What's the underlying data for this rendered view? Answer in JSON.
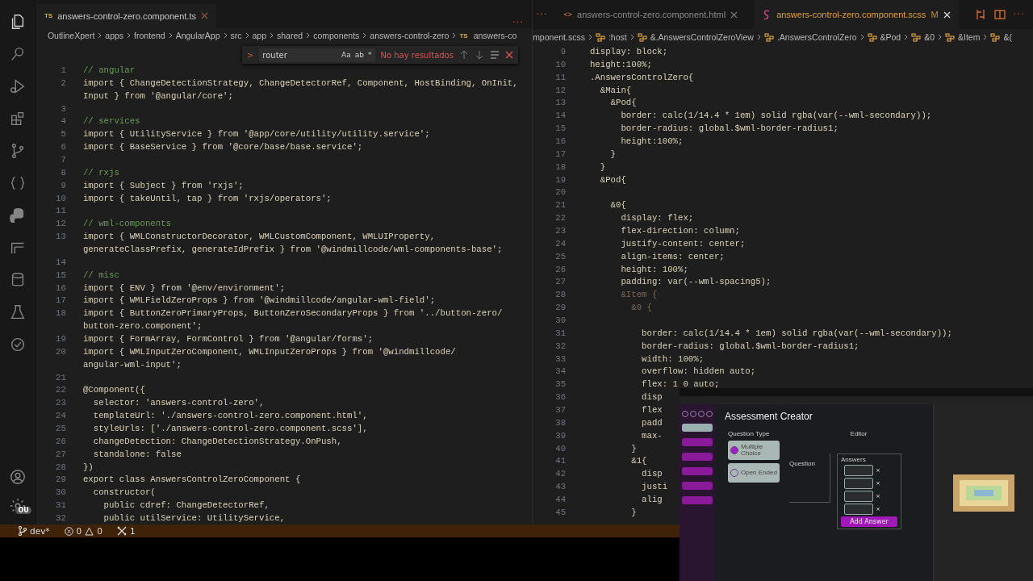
{
  "activity_bar": {
    "items": [
      {
        "kind": "files",
        "selected": true
      },
      {
        "kind": "search",
        "selected": false
      },
      {
        "kind": "run",
        "selected": false
      },
      {
        "kind": "extensions",
        "selected": false
      },
      {
        "kind": "branch",
        "selected": false
      },
      {
        "kind": "braces",
        "selected": false
      },
      {
        "kind": "python",
        "selected": false
      },
      {
        "kind": "panel",
        "selected": false
      },
      {
        "kind": "database",
        "selected": false
      },
      {
        "kind": "tests",
        "selected": false
      },
      {
        "kind": "check",
        "selected": false
      }
    ],
    "account_badge": "OU"
  },
  "left_editor": {
    "tabs": [
      {
        "icon": "TS",
        "label": "answers-control-zero.component.ts",
        "selected": true
      }
    ],
    "more": "···",
    "breadcrumbs": [
      "OutlineXpert",
      "apps",
      "frontend",
      "AngularApp",
      "src",
      "app",
      "shared",
      "components",
      "answers-control-zero",
      "answers-co"
    ],
    "breadcrumb_file_icon": "TS",
    "find": {
      "chevron": ">",
      "value": "router",
      "options": [
        "Aa",
        "ab",
        "*"
      ],
      "result": "No hay resultados"
    },
    "lines": [
      {
        "n": "1",
        "text": "// angular",
        "kind": "comment"
      },
      {
        "n": "2",
        "text": "import { ChangeDetectionStrategy, ChangeDetectorRef, Component, HostBinding, OnInit,",
        "kind": "code"
      },
      {
        "text": "Input } from '@angular/core';",
        "kind": "code"
      },
      {
        "n": "3"
      },
      {
        "n": "4",
        "text": "// services",
        "kind": "comment"
      },
      {
        "n": "5",
        "text": "import { UtilityService } from '@app/core/utility/utility.service';",
        "kind": "code"
      },
      {
        "n": "6",
        "text": "import { BaseService } from '@core/base/base.service';",
        "kind": "code"
      },
      {
        "n": "7"
      },
      {
        "n": "8",
        "text": "// rxjs",
        "kind": "comment"
      },
      {
        "n": "9",
        "text": "import { Subject } from 'rxjs';",
        "kind": "code"
      },
      {
        "n": "10",
        "text": "import { takeUntil, tap } from 'rxjs/operators';",
        "kind": "code"
      },
      {
        "n": "11"
      },
      {
        "n": "12",
        "text": "// wml-components",
        "kind": "comment"
      },
      {
        "n": "13",
        "text": "import { WMLConstructorDecorator, WMLCustomComponent, WMLUIProperty,",
        "kind": "code"
      },
      {
        "text": "generateClassPrefix, generateIdPrefix } from '@windmillcode/wml-components-base';",
        "kind": "code"
      },
      {
        "n": "14"
      },
      {
        "n": "15",
        "text": "// misc",
        "kind": "comment"
      },
      {
        "n": "16",
        "text": "import { ENV } from '@env/environment';",
        "kind": "code"
      },
      {
        "n": "17",
        "text": "import { WMLFieldZeroProps } from '@windmillcode/angular-wml-field';",
        "kind": "code"
      },
      {
        "n": "18",
        "text": "import { ButtonZeroPrimaryProps, ButtonZeroSecondaryProps } from '../button-zero/",
        "kind": "code"
      },
      {
        "text": "button-zero.component';",
        "kind": "code"
      },
      {
        "n": "19",
        "text": "import { FormArray, FormControl } from '@angular/forms';",
        "kind": "code"
      },
      {
        "n": "20",
        "text": "import { WMLInputZeroComponent, WMLInputZeroProps } from '@windmillcode/",
        "kind": "code"
      },
      {
        "text": "angular-wml-input';",
        "kind": "code"
      },
      {
        "n": "21"
      },
      {
        "n": "22",
        "text": "@Component({",
        "kind": "code"
      },
      {
        "n": "23",
        "text": "  selector: 'answers-control-zero',",
        "kind": "code"
      },
      {
        "n": "24",
        "text": "  templateUrl: './answers-control-zero.component.html',",
        "kind": "code"
      },
      {
        "n": "25",
        "text": "  styleUrls: ['./answers-control-zero.component.scss'],",
        "kind": "code"
      },
      {
        "n": "26",
        "text": "  changeDetection: ChangeDetectionStrategy.OnPush,",
        "kind": "code"
      },
      {
        "n": "27",
        "text": "  standalone: false",
        "kind": "code"
      },
      {
        "n": "28",
        "text": "})",
        "kind": "code"
      },
      {
        "n": "29",
        "text": "export class AnswersControlZeroComponent {",
        "kind": "code"
      },
      {
        "n": "30",
        "text": "  constructor(",
        "kind": "code"
      },
      {
        "n": "31",
        "text": "    public cdref: ChangeDetectorRef,",
        "kind": "code"
      },
      {
        "n": "32",
        "text": "    public utilService: UtilityService,",
        "kind": "code"
      }
    ]
  },
  "right_editor": {
    "tabs": [
      {
        "kind": "html",
        "icon": "<>",
        "label": "answers-control-zero.component.html",
        "selected": false
      },
      {
        "kind": "scss",
        "label": "answers-control-zero.component.scss",
        "modified": "M",
        "selected": true
      }
    ],
    "more": "···",
    "breadcrumbs": [
      "mponent.scss",
      ":host",
      "&.AnswersControlZeroView",
      ".AnswersControlZero",
      "&Pod",
      "&0",
      "&Item",
      "&("
    ],
    "lines": [
      {
        "n": "9",
        "text": "  display: block;",
        "kind": "code"
      },
      {
        "n": "10",
        "text": "  height:100%;",
        "kind": "code"
      },
      {
        "n": "11",
        "text": "  .AnswersControlZero{",
        "kind": "code"
      },
      {
        "n": "12",
        "text": "    &Main{",
        "kind": "code"
      },
      {
        "n": "13",
        "text": "      &Pod{",
        "kind": "code"
      },
      {
        "n": "14",
        "text": "        border: calc(1/14.4 * 1em) solid rgba(var(--wml-secondary));",
        "kind": "code"
      },
      {
        "n": "15",
        "text": "        border-radius: global.$wml-border-radius1;",
        "kind": "code"
      },
      {
        "n": "16",
        "text": "        height:100%;",
        "kind": "code"
      },
      {
        "n": "17",
        "text": "      }",
        "kind": "code"
      },
      {
        "n": "18",
        "text": "    }",
        "kind": "code"
      },
      {
        "n": "19",
        "text": "    &Pod{",
        "kind": "code"
      },
      {
        "n": "20"
      },
      {
        "n": "21",
        "text": "      &0{",
        "kind": "code"
      },
      {
        "n": "22",
        "text": "        display: flex;",
        "kind": "code"
      },
      {
        "n": "23",
        "text": "        flex-direction: column;",
        "kind": "code"
      },
      {
        "n": "24",
        "text": "        justify-content: center;",
        "kind": "code"
      },
      {
        "n": "25",
        "text": "        align-items: center;",
        "kind": "code"
      },
      {
        "n": "26",
        "text": "        height: 100%;",
        "kind": "code"
      },
      {
        "n": "27",
        "text": "        padding: var(--wml-spacing5);",
        "kind": "code"
      },
      {
        "n": "28",
        "text": "        &Item {",
        "kind": "dim"
      },
      {
        "n": "29",
        "text": "          &0 {",
        "kind": "dim"
      },
      {
        "n": "30"
      },
      {
        "n": "31",
        "text": "            border: calc(1/14.4 * 1em) solid rgba(var(--wml-secondary));",
        "kind": "code"
      },
      {
        "n": "32",
        "text": "            border-radius: global.$wml-border-radius1;",
        "kind": "code"
      },
      {
        "n": "33",
        "text": "            width: 100%;",
        "kind": "code"
      },
      {
        "n": "34",
        "text": "            overflow: hidden auto;",
        "kind": "code"
      },
      {
        "n": "35",
        "text": "            flex: 1 0 auto;",
        "kind": "code"
      },
      {
        "n": "36",
        "text": "            disp",
        "kind": "code"
      },
      {
        "n": "37",
        "text": "            flex",
        "kind": "code"
      },
      {
        "n": "38",
        "text": "            padd",
        "kind": "code"
      },
      {
        "n": "39",
        "text": "            max-",
        "kind": "code"
      },
      {
        "n": "40",
        "text": "          }",
        "kind": "code"
      },
      {
        "n": "41",
        "text": "          &1{",
        "kind": "code"
      },
      {
        "n": "42",
        "text": "            disp",
        "kind": "code"
      },
      {
        "n": "43",
        "text": "            justi",
        "kind": "code"
      },
      {
        "n": "44",
        "text": "            alig",
        "kind": "code"
      },
      {
        "n": "45",
        "text": "          }",
        "kind": "code"
      }
    ]
  },
  "status_bar": {
    "branch": "dev*",
    "errors": "0",
    "warnings": "0",
    "ports": "1"
  },
  "preview": {
    "nav": [
      {
        "selected": true
      },
      {
        "selected": false
      },
      {
        "selected": false
      },
      {
        "selected": false
      },
      {
        "selected": false
      },
      {
        "selected": false
      }
    ],
    "title": "Assessment Creator",
    "question_type_label": "Question Type",
    "options": [
      {
        "label": "Multiple Choice",
        "selected": true
      },
      {
        "label": "Open Ended",
        "selected": false
      }
    ],
    "editor_label": "Editor",
    "question_label": "Question",
    "answers_label": "Answers",
    "answer_remove": "×",
    "add_answer": "Add Answer"
  }
}
